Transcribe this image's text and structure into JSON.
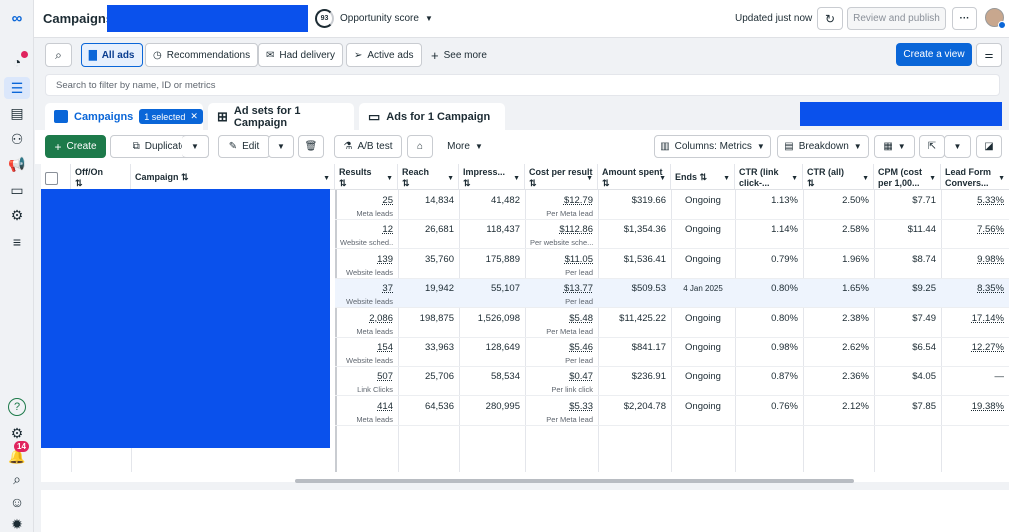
{
  "topbar": {
    "title": "Campaigns",
    "score_value": "93",
    "score_label": "Opportunity score",
    "updated": "Updated just now",
    "review_label": "Review and publish"
  },
  "filters": {
    "all_ads": "All ads",
    "recommendations": "Recommendations",
    "had_delivery": "Had delivery",
    "active_ads": "Active ads",
    "see_more": "See more",
    "create_view": "Create a view"
  },
  "search": {
    "placeholder": "Search to filter by name, ID or metrics"
  },
  "tabs": {
    "campaigns": "Campaigns",
    "selected_chip": "1 selected",
    "adsets": "Ad sets for 1 Campaign",
    "ads": "Ads for 1 Campaign"
  },
  "toolbar": {
    "create": "Create",
    "duplicate": "Duplicate",
    "edit": "Edit",
    "ab_test": "A/B test",
    "more": "More",
    "columns": "Columns: Metrics",
    "breakdown": "Breakdown"
  },
  "rail": {
    "notification_count": "14"
  },
  "table": {
    "headers": {
      "offon": "Off/On",
      "campaign": "Campaign",
      "results": "Results",
      "reach": "Reach",
      "impressions": "Impress...",
      "cost": "Cost per result",
      "amount": "Amount spent",
      "ends": "Ends",
      "ctr_link": "CTR (link click-...",
      "ctr_all": "CTR (all)",
      "cpm": "CPM (cost per 1,00...",
      "leadform": "Lead Form Convers..."
    },
    "rows": [
      {
        "results": "25",
        "results_sub": "Meta leads",
        "reach": "14,834",
        "impressions": "41,482",
        "cost": "$12.79",
        "cost_sub": "Per Meta lead",
        "amount": "$319.66",
        "ends": "Ongoing",
        "ctr_link": "1.13%",
        "ctr_all": "2.50%",
        "cpm": "$7.71",
        "leadform": "5.33%"
      },
      {
        "results": "12",
        "results_sub": "Website sched...",
        "reach": "26,681",
        "impressions": "118,437",
        "cost": "$112.86",
        "cost_sub": "Per website sche...",
        "amount": "$1,354.36",
        "ends": "Ongoing",
        "ctr_link": "1.14%",
        "ctr_all": "2.58%",
        "cpm": "$11.44",
        "leadform": "7.56%"
      },
      {
        "results": "139",
        "results_sub": "Website leads",
        "reach": "35,760",
        "impressions": "175,889",
        "cost": "$11.05",
        "cost_sub": "Per lead",
        "amount": "$1,536.41",
        "ends": "Ongoing",
        "ctr_link": "0.79%",
        "ctr_all": "1.96%",
        "cpm": "$8.74",
        "leadform": "9.98%"
      },
      {
        "results": "37",
        "results_sub": "Website leads",
        "reach": "19,942",
        "impressions": "55,107",
        "cost": "$13.77",
        "cost_sub": "Per lead",
        "amount": "$509.53",
        "ends": "4 Jan 2025",
        "ctr_link": "0.80%",
        "ctr_all": "1.65%",
        "cpm": "$9.25",
        "leadform": "8.35%"
      },
      {
        "results": "2,086",
        "results_sub": "Meta leads",
        "reach": "198,875",
        "impressions": "1,526,098",
        "cost": "$5.48",
        "cost_sub": "Per Meta lead",
        "amount": "$11,425.22",
        "ends": "Ongoing",
        "ctr_link": "0.80%",
        "ctr_all": "2.38%",
        "cpm": "$7.49",
        "leadform": "17.14%"
      },
      {
        "results": "154",
        "results_sub": "Website leads",
        "reach": "33,963",
        "impressions": "128,649",
        "cost": "$5.46",
        "cost_sub": "Per lead",
        "amount": "$841.17",
        "ends": "Ongoing",
        "ctr_link": "0.98%",
        "ctr_all": "2.62%",
        "cpm": "$6.54",
        "leadform": "12.27%"
      },
      {
        "results": "507",
        "results_sub": "Link Clicks",
        "reach": "25,706",
        "impressions": "58,534",
        "cost": "$0.47",
        "cost_sub": "Per link click",
        "amount": "$236.91",
        "ends": "Ongoing",
        "ctr_link": "0.87%",
        "ctr_all": "2.36%",
        "cpm": "$4.05",
        "leadform": "—"
      },
      {
        "results": "414",
        "results_sub": "Meta leads",
        "reach": "64,536",
        "impressions": "280,995",
        "cost": "$5.33",
        "cost_sub": "Per Meta lead",
        "amount": "$2,204.78",
        "ends": "Ongoing",
        "ctr_link": "0.76%",
        "ctr_all": "2.12%",
        "cpm": "$7.85",
        "leadform": "19.38%"
      }
    ]
  },
  "colors": {
    "accent": "#0a66d8",
    "redaction": "#0a51ec",
    "create_green": "#1d7a4a"
  }
}
